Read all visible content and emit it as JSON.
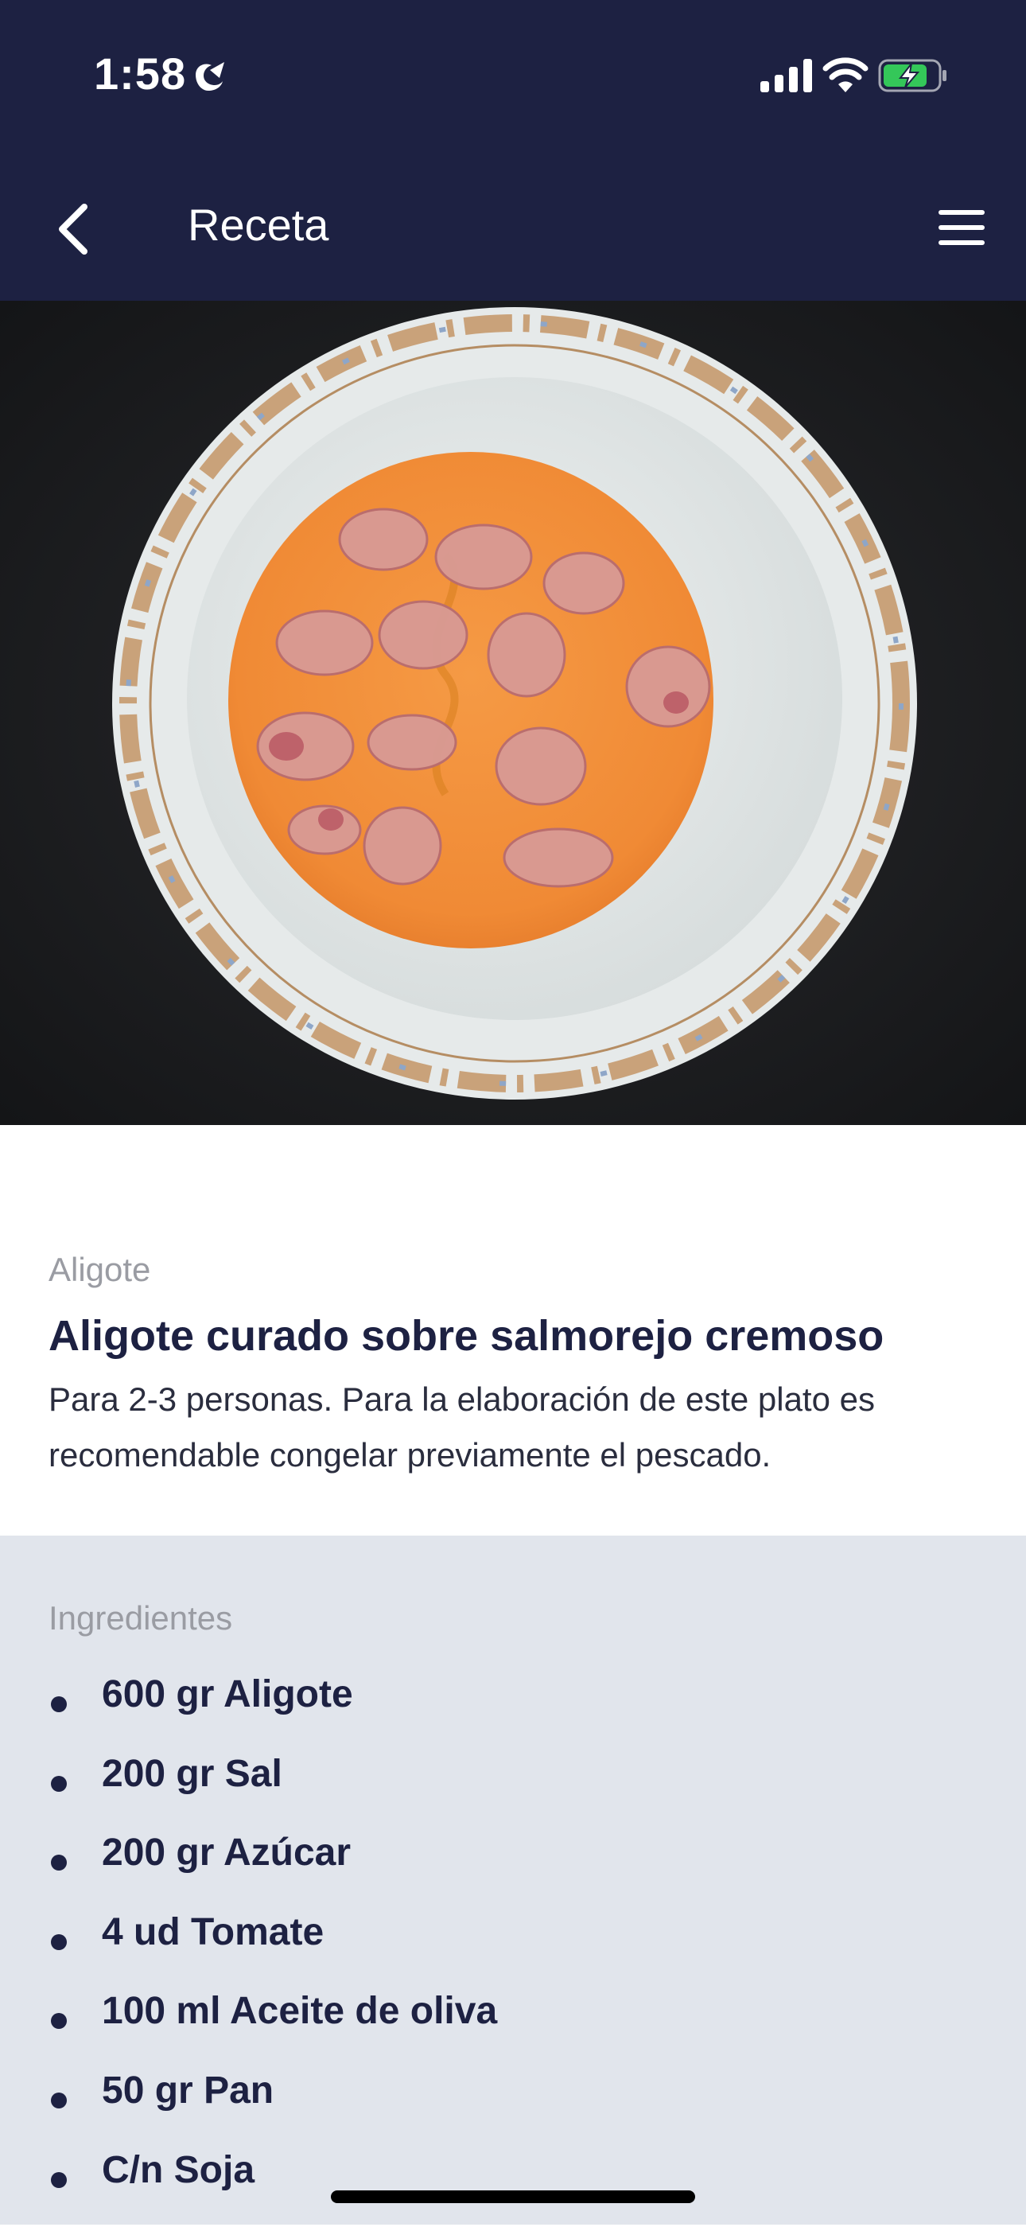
{
  "status_bar": {
    "time": "1:58",
    "focus_icon": "sleep-focus-icon",
    "signal_icon": "cellular-signal-icon",
    "wifi_icon": "wifi-icon",
    "battery_icon": "battery-charging-icon"
  },
  "nav": {
    "back_icon": "chevron-left-icon",
    "title": "Receta",
    "menu_icon": "hamburger-menu-icon"
  },
  "recipe": {
    "category": "Aligote",
    "title": "Aligote curado sobre salmorejo cremoso",
    "description": "Para 2-3 personas. Para la elaboración de este plato es recomendable congelar previamente el pescado."
  },
  "ingredients": {
    "heading": "Ingredientes",
    "items": [
      "600 gr Aligote",
      "200 gr Sal",
      "200 gr Azúcar",
      "4 ud Tomate",
      "100 ml Aceite de oliva",
      "50 gr Pan",
      "C/n Soja"
    ]
  },
  "colors": {
    "header_bg": "#1d2142",
    "ingredients_bg": "#e1e5ec",
    "text_dark": "#1d2142",
    "text_muted": "#9a9ca3",
    "battery_green": "#34c759"
  }
}
